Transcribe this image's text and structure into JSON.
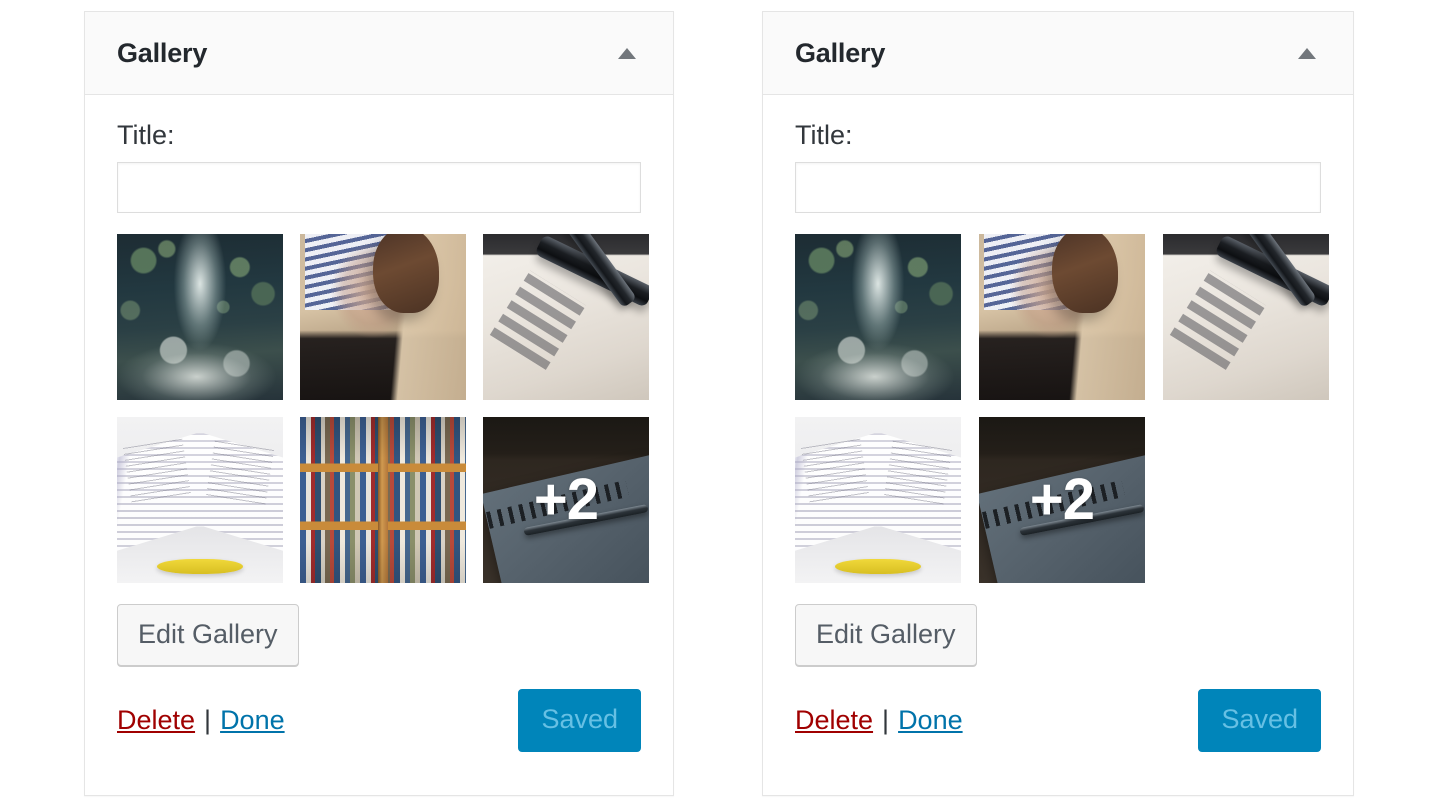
{
  "page": {
    "background_color": "#ffffff",
    "widget_count": 2
  },
  "colors": {
    "panel_border": "#e5e5e5",
    "panel_header_bg": "#fafafa",
    "title_text": "#23282d",
    "label_text": "#32373c",
    "input_border": "#dddddd",
    "toggle_arrow": "#72777c",
    "secondary_button_bg": "#f7f7f7",
    "secondary_button_border": "#cccccc",
    "secondary_button_text": "#555d66",
    "delete_link": "#a00000",
    "done_link": "#0073aa",
    "primary_button_bg": "#0085ba",
    "primary_button_text_disabled": "#66c0e4",
    "overlay_count_text": "#ffffff"
  },
  "widgets": [
    {
      "header": {
        "title": "Gallery",
        "toggle_icon": "triangle-up-icon",
        "toggle_state": "expanded"
      },
      "form": {
        "title_field": {
          "label": "Title:",
          "value": "",
          "placeholder": ""
        }
      },
      "gallery": {
        "visible_thumbnail_count": 6,
        "overflow_count_label": "+2",
        "overflow_count": 2,
        "total_images": 8,
        "thumbnails": [
          {
            "name": "forest-path-photo",
            "art": "art-forest",
            "overlay": ""
          },
          {
            "name": "person-sitting-beach-photo",
            "art": "art-person",
            "overlay": ""
          },
          {
            "name": "fountain-pens-paper-photo",
            "art": "art-pens",
            "overlay": ""
          },
          {
            "name": "open-book-photo",
            "art": "art-book",
            "overlay": ""
          },
          {
            "name": "bookshelf-photo",
            "art": "art-shelf",
            "overlay": ""
          },
          {
            "name": "notebook-pen-photo",
            "art": "art-notebook",
            "overlay": "+2"
          }
        ]
      },
      "actions": {
        "edit_gallery_label": "Edit Gallery",
        "delete_label": "Delete",
        "separator": "|",
        "done_label": "Done",
        "save_label": "Saved",
        "save_disabled": true
      }
    },
    {
      "header": {
        "title": "Gallery",
        "toggle_icon": "triangle-up-icon",
        "toggle_state": "expanded"
      },
      "form": {
        "title_field": {
          "label": "Title:",
          "value": "",
          "placeholder": ""
        }
      },
      "gallery": {
        "visible_thumbnail_count": 5,
        "overflow_count_label": "+2",
        "overflow_count": 2,
        "total_images": 7,
        "thumbnails": [
          {
            "name": "forest-path-photo",
            "art": "art-forest",
            "overlay": ""
          },
          {
            "name": "person-sitting-beach-photo",
            "art": "art-person",
            "overlay": ""
          },
          {
            "name": "fountain-pens-paper-photo",
            "art": "art-pens",
            "overlay": ""
          },
          {
            "name": "open-book-photo",
            "art": "art-book",
            "overlay": ""
          },
          {
            "name": "notebook-pen-photo",
            "art": "art-notebook",
            "overlay": "+2"
          }
        ]
      },
      "actions": {
        "edit_gallery_label": "Edit Gallery",
        "delete_label": "Delete",
        "separator": "|",
        "done_label": "Done",
        "save_label": "Saved",
        "save_disabled": true
      }
    }
  ]
}
